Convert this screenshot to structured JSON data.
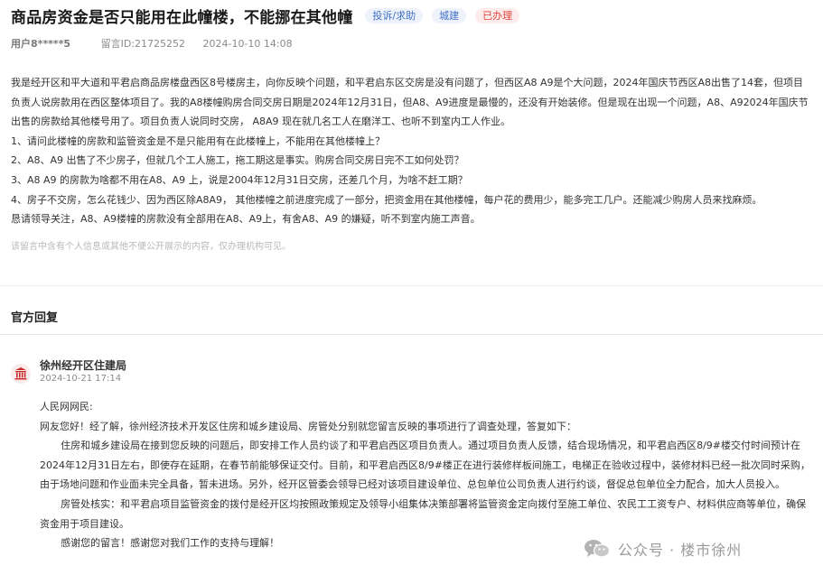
{
  "header": {
    "title": "商品房资金是否只能用在此幢楼，不能挪在其他幢",
    "tag_type": "投诉/求助",
    "tag_field": "城建",
    "tag_status": "已办理"
  },
  "meta": {
    "user": "用户8*****5",
    "message_id": "留言ID:21725252",
    "date": "2024-10-10 14:08"
  },
  "message": {
    "paragraphs": [
      "我是经开区和平大道和平君启商品房楼盘西区8号楼房主，向你反映个问题，和平君启东区交房是没有问题了，但西区A8 A9是个大问题，2024年国庆节西区A8出售了14套，但项目负责人说房款用在西区整体项目了。我的A8楼幢购房合同交房日期是2024年12月31日，但A8、A9进度是最慢的，还没有开始装修。但是现在出现一个问题，A8、A92024年国庆节出售的房款给其他楼号用了。项目负责人说同时交房， A8A9 现在就几名工人在磨洋工、也听不到室内工人作业。",
      "1、请问此楼幢的房款和监管资金是不是只能用有在此楼幢上，不能用在其他楼幢上？",
      "2、A8、A9 出售了不少房子，但就几个工人施工，拖工期这是事实。购房合同交房日完不工如何处罚？",
      "3、A8 A9 的房款为啥都不用在A8、A9 上，说是2004年12月31日交房，还差几个月，为啥不赶工期？",
      "4、房子不交房，怎么花钱少、因为西区除A8A9，  其他楼幢之前进度完成了一部分，把资金用在其他楼幢，每户花的费用少，能多完工几户。还能减少购房人员来找麻烦。",
      "恳请领导关注，A8、A9楼幢的房款没有全部用在A8、A9上，有舍A8、A9 的嫌疑，听不到室内施工声音。"
    ],
    "notice": "该留言中含有个人信息或其他不便公开展示的内容，仅办理机构可见。"
  },
  "official_reply": {
    "section_title": "官方回复",
    "org_icon": "government-emblem-icon",
    "org_name": "徐州经开区住建局",
    "reply_time": "2024-10-21 17:14",
    "salutation": "人民网网民:",
    "intro": "网友您好！经了解，徐州经济技术开发区住房和城乡建设局、房管处分别就您留言反映的事项进行了调查处理，答复如下：",
    "body": [
      "住房和城乡建设局在接到您反映的问题后，即安排工作人员约谈了和平君启西区项目负责人。通过项目负责人反馈，结合现场情况，和平君启西区8/9#楼交付时间预计在2024年12月31日左右，即使存在延期，在春节前能够保证交付。目前，和平君启西区8/9#楼正在进行装修样板间施工，电梯正在验收过程中，装修材料已经一批次同时采购，由于场地问题和作业面未完全具备，暂未进场。另外，经开区管委会领导已经对该项目建设单位、总包单位公司负责人进行约谈，督促总包单位全力配合，加大人员投入。",
      "房管处核实：和平君启项目监管资金的拨付是经开区均按照政策规定及领导小组集体决策部署将监管资金定向拨付至施工单位、农民工工资专户、材料供应商等单位，确保资金用于项目建设。",
      "感谢您的留言！感谢您对我们工作的支持与理解！"
    ]
  },
  "watermark": {
    "icon": "wechat-icon",
    "text": "公众号 · 楼市徐州"
  },
  "colors": {
    "tag_blue": "#3f6fc4",
    "tag_red": "#e0463f",
    "emblem_red": "#c9302c"
  }
}
